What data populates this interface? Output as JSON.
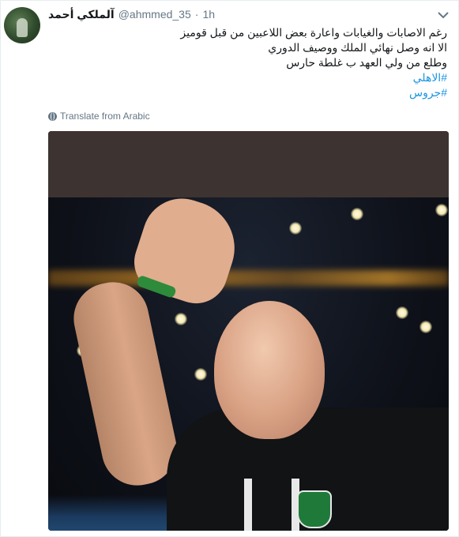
{
  "tweet": {
    "display_name": "آلملكي أحمد",
    "screen_name": "@ahmmed_35",
    "separator": "·",
    "time": "1h",
    "text_lines": [
      "رغم الاصابات والغيابات واعارة بعض اللاعبين من قبل قوميز",
      "الا انه وصل نهائي الملك ووصيف الدوري",
      "وطلع من ولي العهد ب غلطة حارس"
    ],
    "hashtags": [
      "#الاهلي",
      "#جروس"
    ],
    "translate_label": "Translate from Arabic"
  },
  "icons": {
    "caret": "chevron-down-icon",
    "translate": "globe-icon"
  },
  "colors": {
    "link": "#1b95e0",
    "secondary_text": "#657786",
    "border": "#e6ecf0"
  }
}
